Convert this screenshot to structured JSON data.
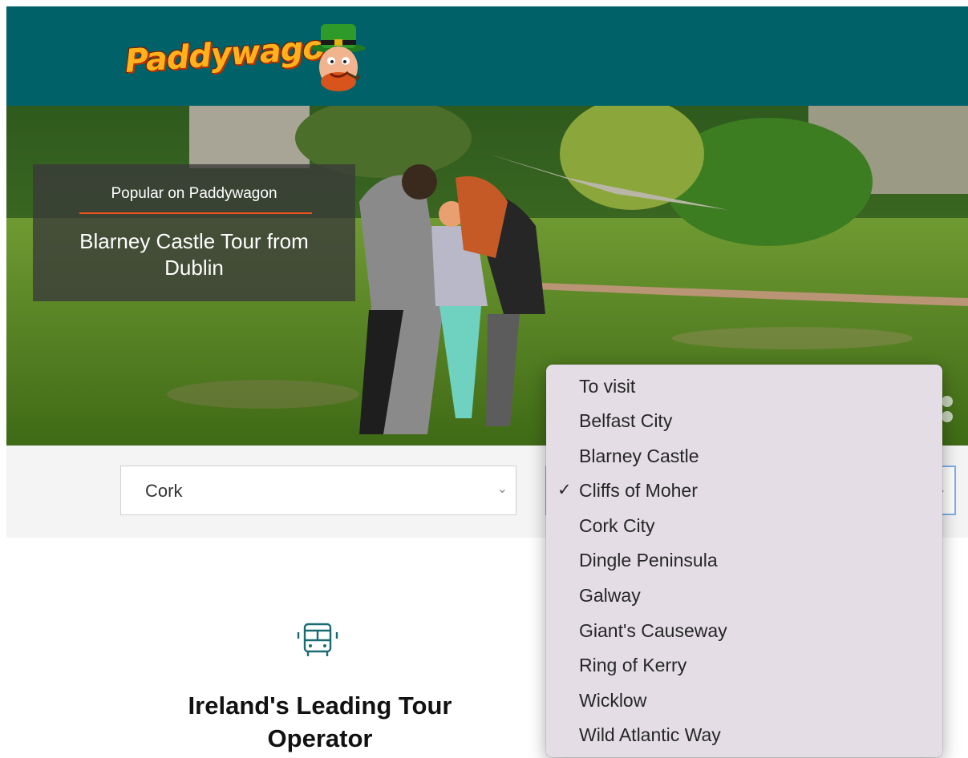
{
  "header": {
    "logo_text": "Paddywagon"
  },
  "hero": {
    "promo_kicker": "Popular on Paddywagon",
    "promo_title": "Blarney Castle Tour from Dublin"
  },
  "search": {
    "location_value": "Cork"
  },
  "dropdown": {
    "items": [
      {
        "label": "To visit",
        "checked": false
      },
      {
        "label": "Belfast City",
        "checked": false
      },
      {
        "label": "Blarney Castle",
        "checked": false
      },
      {
        "label": "Cliffs of Moher",
        "checked": true
      },
      {
        "label": "Cork City",
        "checked": false
      },
      {
        "label": "Dingle Peninsula",
        "checked": false
      },
      {
        "label": "Galway",
        "checked": false
      },
      {
        "label": "Giant's Causeway",
        "checked": false
      },
      {
        "label": "Ring of Kerry",
        "checked": false
      },
      {
        "label": "Wicklow",
        "checked": false
      },
      {
        "label": "Wild Atlantic Way",
        "checked": false
      }
    ],
    "check_glyph": "✓"
  },
  "intro": {
    "title": "Ireland's Leading Tour Operator",
    "icon": "bus-icon"
  },
  "colors": {
    "header": "#006168",
    "accent": "#e8531b",
    "icon": "#1b6b72"
  }
}
